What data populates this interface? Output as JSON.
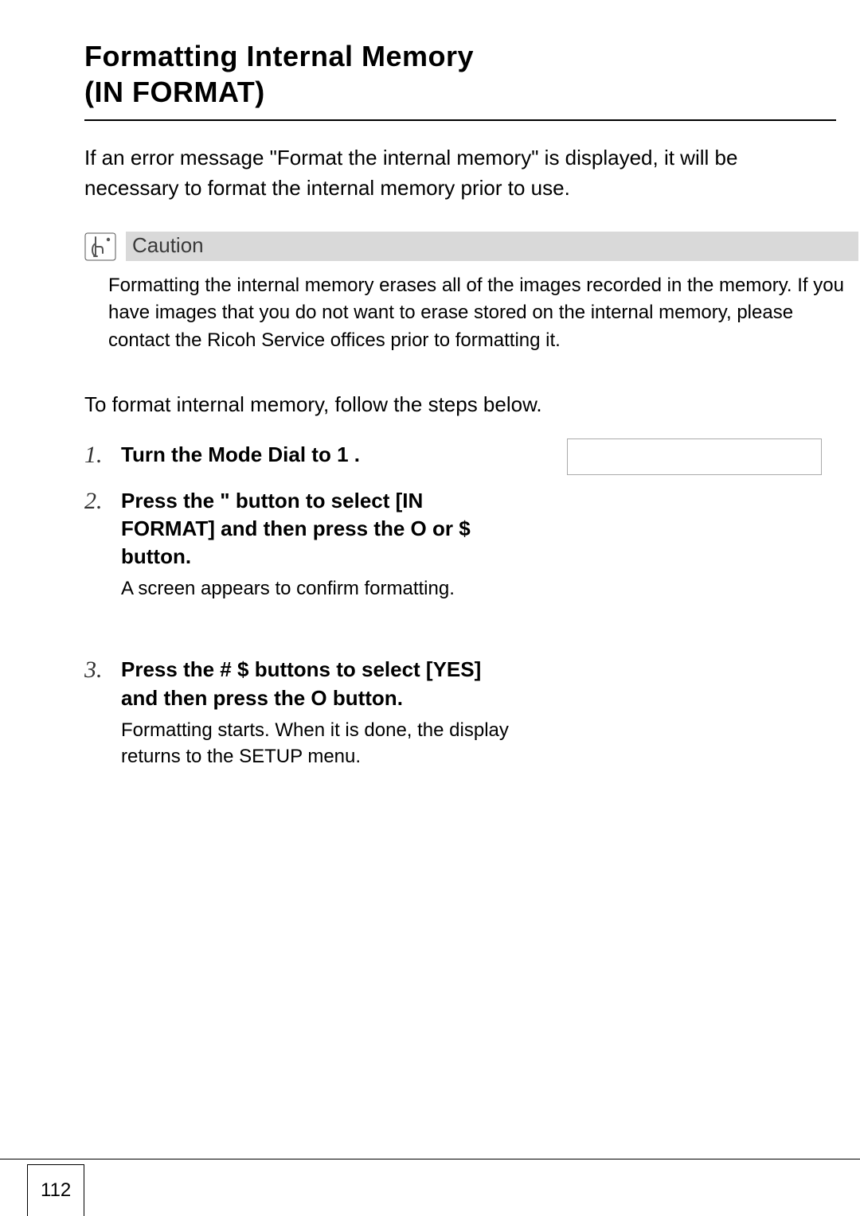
{
  "title_line1": "Formatting Internal Memory",
  "title_line2": "(IN FORMAT)",
  "intro": "If an error message \"Format the internal memory\" is displayed, it will be necessary to format the internal memory prior to use.",
  "caution_label": "Caution",
  "caution_body": "Formatting the internal memory erases all of the images recorded in the memory. If you have images that you do not want to erase stored on the internal memory, please contact the Ricoh Service offices prior to formatting it.",
  "lead": "To format internal memory, follow the steps below.",
  "steps": [
    {
      "num": "1",
      "title_parts": [
        "Turn the Mode Dial to ",
        "1",
        "     ."
      ],
      "sub": ""
    },
    {
      "num": "2",
      "title_parts": [
        "Press the ",
        "\"",
        "   button to select [IN FORMAT] and then press the ",
        "O",
        " or ",
        "$",
        "  button."
      ],
      "sub": "A screen appears to confirm formatting."
    },
    {
      "num": "3",
      "title_parts": [
        "Press the ",
        "#",
        " ",
        "$",
        "  buttons to select [YES] and then press the ",
        "O",
        " button."
      ],
      "sub": "Formatting starts. When it is done, the display returns to the SETUP menu."
    }
  ],
  "page_number": "112"
}
